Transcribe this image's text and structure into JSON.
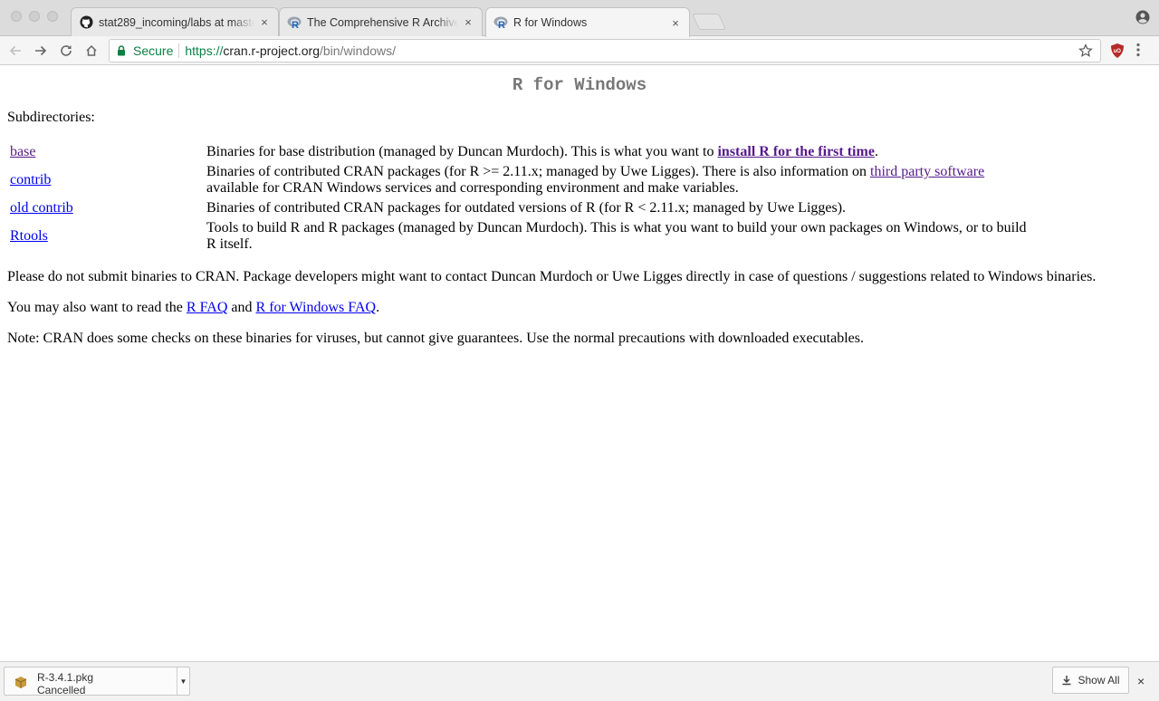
{
  "browser": {
    "tabs": [
      {
        "title": "stat289_incoming/labs at master",
        "favicon": "github-icon",
        "active": false
      },
      {
        "title": "The Comprehensive R Archive Network",
        "favicon": "r-logo-icon",
        "active": false
      },
      {
        "title": "R for Windows",
        "favicon": "r-logo-icon",
        "active": true
      }
    ],
    "close_glyph": "×",
    "address": {
      "secure_label": "Secure",
      "url_scheme": "https://",
      "url_host": "cran.r-project.org",
      "url_path": "/bin/windows/"
    }
  },
  "page": {
    "title": "R for Windows",
    "subdirectories_heading": "Subdirectories:",
    "directories": [
      {
        "name": "base",
        "desc_before": "Binaries for base distribution (managed by Duncan Murdoch). This is what you want to ",
        "desc_link": "install R for the first time",
        "desc_after": "."
      },
      {
        "name": "contrib",
        "desc_before": "Binaries of contributed CRAN packages (for R >= 2.11.x; managed by Uwe Ligges). There is also information on ",
        "desc_link": "third party software",
        "desc_after": " available for CRAN Windows services and corresponding environment and make variables."
      },
      {
        "name": "old contrib",
        "desc": "Binaries of contributed CRAN packages for outdated versions of R (for R < 2.11.x; managed by Uwe Ligges)."
      },
      {
        "name": "Rtools",
        "desc": "Tools to build R and R packages (managed by Duncan Murdoch). This is what you want to build your own packages on Windows, or to build R itself."
      }
    ],
    "para_submit": "Please do not submit binaries to CRAN. Package developers might want to contact Duncan Murdoch or Uwe Ligges directly in case of questions / suggestions related to Windows binaries.",
    "para_faq_before": "You may also want to read the ",
    "faq_link_1": "R FAQ",
    "para_faq_middle": " and ",
    "faq_link_2": "R for Windows FAQ",
    "para_faq_after": ".",
    "para_note": "Note: CRAN does some checks on these binaries for viruses, but cannot give guarantees. Use the normal precautions with downloaded executables."
  },
  "downloads": {
    "item": {
      "filename": "R-3.4.1.pkg",
      "status": "Cancelled"
    },
    "show_all_label": "Show All",
    "close_glyph": "×"
  },
  "colors": {
    "link": "#0000ee",
    "visited_link": "#551a8b",
    "secure_green": "#0b8043",
    "title_gray": "#777777"
  }
}
